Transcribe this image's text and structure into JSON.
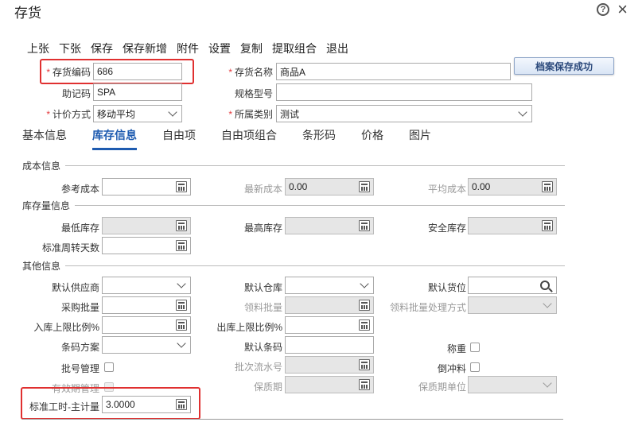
{
  "window": {
    "title": "存货"
  },
  "toolbar": [
    "上张",
    "下张",
    "保存",
    "保存新增",
    "附件",
    "设置",
    "复制",
    "提取组合",
    "退出"
  ],
  "toast": "档案保存成功",
  "header": {
    "code_label": "存货编码",
    "code_value": "686",
    "name_label": "存货名称",
    "name_value": "商品A",
    "mnemonic_label": "助记码",
    "mnemonic_value": "SPA",
    "spec_label": "规格型号",
    "spec_value": "",
    "pricing_label": "计价方式",
    "pricing_value": "移动平均",
    "category_label": "所属类别",
    "category_value": "测试"
  },
  "tabs": [
    "基本信息",
    "库存信息",
    "自由项",
    "自由项组合",
    "条形码",
    "价格",
    "图片"
  ],
  "sections": {
    "cost": "成本信息",
    "stock": "库存量信息",
    "other": "其他信息"
  },
  "fields": {
    "ref_cost": "参考成本",
    "ref_cost_value": "",
    "latest_cost": "最新成本",
    "latest_cost_value": "0.00",
    "avg_cost": "平均成本",
    "avg_cost_value": "0.00",
    "min_stock": "最低库存",
    "max_stock": "最高库存",
    "safe_stock": "安全库存",
    "turnover_days": "标准周转天数",
    "default_supplier": "默认供应商",
    "default_warehouse": "默认仓库",
    "default_location": "默认货位",
    "purchase_batch": "采购批量",
    "pick_batch": "领料批量",
    "pick_batch_method": "领料批量处理方式",
    "in_upper_pct": "入库上限比例%",
    "out_upper_pct": "出库上限比例%",
    "barcode_scheme": "条码方案",
    "default_barcode": "默认条码",
    "weighing": "称重",
    "batch_mgmt": "批号管理",
    "batch_serial": "批次流水号",
    "backflush": "倒冲料",
    "expiry_mgmt": "有效期管理",
    "shelf_life": "保质期",
    "shelf_life_unit": "保质期单位",
    "std_hours": "标准工时-主计量",
    "std_hours_value": "3.0000"
  }
}
